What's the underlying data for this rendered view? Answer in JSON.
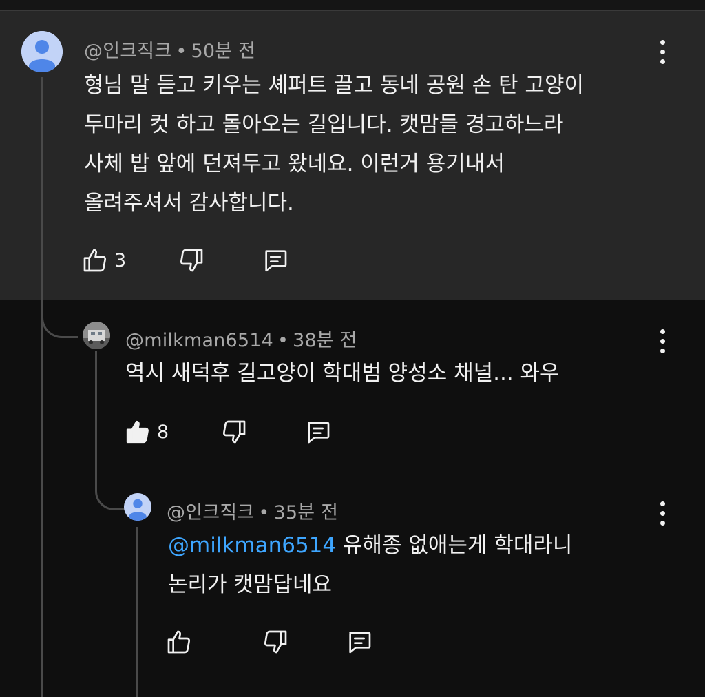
{
  "comments": [
    {
      "author": "@인크직크",
      "time": "50분 전",
      "text": "형님 말 듣고 키우는 셰퍼트 끌고 동네 공원 손 탄 고양이\n두마리 컷 하고 돌아오는 길입니다. 캣맘들 경고하느라\n사체 밥 앞에 던져두고 왔네요. 이런거 용기내서\n올려주셔서 감사합니다.",
      "likes": "3",
      "liked": false
    },
    {
      "author": "@milkman6514",
      "time": "38분 전",
      "text": "역시 새덕후 길고양이 학대범 양성소 채널... 와우",
      "likes": "8",
      "liked": true
    },
    {
      "author": "@인크직크",
      "time": "35분 전",
      "mention": "@milkman6514",
      "text": " 유해종 없애는게 학대라니\n논리가 캣맘답네요",
      "likes": "",
      "liked": false
    }
  ],
  "separator": "•",
  "colors": {
    "background": "#0f0f0f",
    "highlight": "#272727",
    "mention": "#3ea6ff",
    "avatar": "#c2d3f7",
    "avatar_figure": "#4f86e8"
  },
  "icons": [
    "person-avatar-icon",
    "thumbs-up-icon",
    "thumbs-down-icon",
    "reply-comment-icon",
    "more-vert-icon"
  ]
}
